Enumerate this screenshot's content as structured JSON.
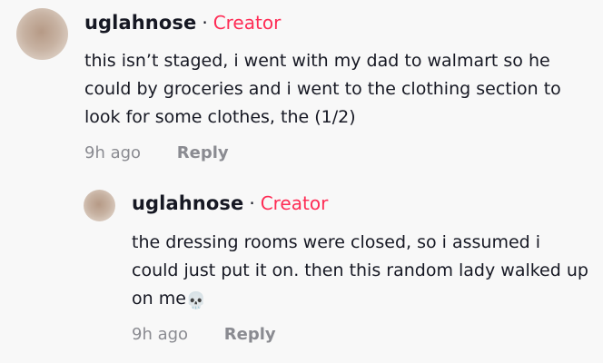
{
  "comments": [
    {
      "username": "uglahnose",
      "separator": "·",
      "badge": "Creator",
      "text": "this isn’t staged, i went with my dad to walmart so he could by groceries and i went to the clothing section to look for some clothes, the (1/2)",
      "time": "9h ago",
      "reply_label": "Reply"
    },
    {
      "username": "uglahnose",
      "separator": "·",
      "badge": "Creator",
      "text": "the dressing rooms were closed, so i assumed i could just put it on. then this random lady walked up on me",
      "emoji": "💀",
      "time": "9h ago",
      "reply_label": "Reply"
    }
  ],
  "colors": {
    "background": "#f8f8f8",
    "creator_badge": "#fe2c55",
    "text": "#161823",
    "muted": "#8a8b91"
  }
}
